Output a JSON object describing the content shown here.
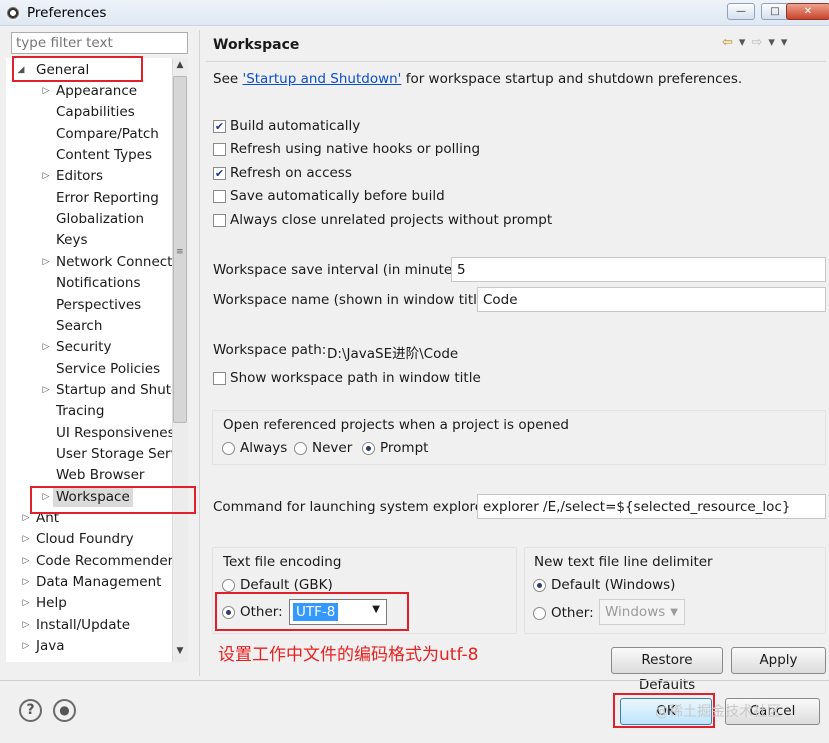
{
  "window": {
    "title": "Preferences",
    "min_symbol": "—",
    "max_symbol": "□",
    "close_symbol": "✕"
  },
  "filter": {
    "placeholder": "type filter text"
  },
  "tree": {
    "general": "General",
    "children": [
      "Appearance",
      "Capabilities",
      "Compare/Patch",
      "Content Types",
      "Editors",
      "Error Reporting",
      "Globalization",
      "Keys",
      "Network Connecti",
      "Notifications",
      "Perspectives",
      "Search",
      "Security",
      "Service Policies",
      "Startup and Shutd",
      "Tracing",
      "UI Responsivenes:",
      "User Storage Serv",
      "Web Browser",
      "Workspace"
    ],
    "roots": [
      "Ant",
      "Cloud Foundry",
      "Code Recommenders",
      "Data Management",
      "Help",
      "Install/Update",
      "Java"
    ]
  },
  "page": {
    "title": "Workspace",
    "desc_prefix": "See ",
    "desc_link": "'Startup and Shutdown'",
    "desc_suffix": " for workspace startup and shutdown preferences."
  },
  "checkboxes": {
    "build_auto": {
      "label": "Build automatically",
      "checked": true
    },
    "refresh_native": {
      "label": "Refresh using native hooks or polling",
      "checked": false
    },
    "refresh_access": {
      "label": "Refresh on access",
      "checked": true
    },
    "save_auto": {
      "label": "Save automatically before build",
      "checked": false
    },
    "close_unrelated": {
      "label": "Always close unrelated projects without prompt",
      "checked": false
    }
  },
  "fields": {
    "save_interval_label": "Workspace save interval (in minutes):",
    "save_interval_value": "5",
    "name_label": "Workspace name (shown in window title):",
    "name_value": "Code",
    "path_label": "Workspace path:",
    "path_value": "D:\\JavaSE进阶\\Code",
    "show_path_label": "Show workspace path in window title"
  },
  "open_projects": {
    "label": "Open referenced projects when a project is opened",
    "options": [
      "Always",
      "Never",
      "Prompt"
    ],
    "selected": "Prompt"
  },
  "explorer": {
    "label": "Command for launching system explorer:",
    "value": "explorer /E,/select=${selected_resource_loc}"
  },
  "encoding": {
    "label": "Text file encoding",
    "default_label": "Default (GBK)",
    "other_label": "Other:",
    "other_value": "UTF-8",
    "selected": "Other"
  },
  "delimiter": {
    "label": "New text file line delimiter",
    "default_label": "Default (Windows)",
    "other_label": "Other:",
    "other_value": "Windows",
    "selected": "Default"
  },
  "annotation": "设置工作中文件的编码格式为utf-8",
  "buttons": {
    "restore": "Restore Defaults",
    "apply": "Apply",
    "ok": "OK",
    "cancel": "Cancel"
  },
  "bottom_icons": {
    "help": "?",
    "record": "●"
  },
  "watermark": "@稀土掘金技术社区",
  "colors": {
    "highlight": "#e0202a",
    "link": "#0b4ecf",
    "selection": "#3399ff"
  }
}
